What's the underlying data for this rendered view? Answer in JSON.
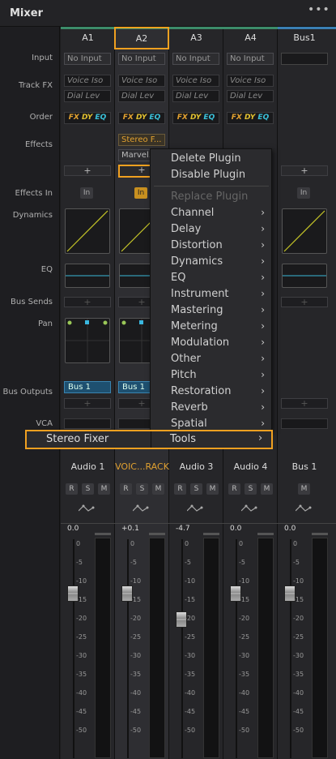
{
  "panel": {
    "title": "Mixer",
    "more": "•••"
  },
  "rows": {
    "input": "Input",
    "track_fx": "Track FX",
    "order": "Order",
    "effects": "Effects",
    "effects_in": "Effects In",
    "dynamics": "Dynamics",
    "eq": "EQ",
    "bus_sends": "Bus Sends",
    "pan": "Pan",
    "bus_outputs": "Bus Outputs",
    "vca": "VCA"
  },
  "channels": [
    {
      "id": "A1",
      "input": "No Input",
      "fx1": "Voice Iso",
      "fx2": "Dial Lev",
      "name": "Audio 1",
      "gain": "0.0",
      "bus_out": "Bus 1"
    },
    {
      "id": "A2",
      "input": "No Input",
      "fx1": "Voice Iso",
      "fx2": "Dial Lev",
      "name": "VOIC...RACK",
      "gain": "+0.1",
      "bus_out": "Bus 1",
      "effect1": "Stereo F...",
      "effect2": "Marvel...",
      "effects_in": "In"
    },
    {
      "id": "A3",
      "input": "No Input",
      "fx1": "Voice Iso",
      "fx2": "Dial Lev",
      "name": "Audio 3",
      "gain": "-4.7"
    },
    {
      "id": "A4",
      "input": "No Input",
      "fx1": "Voice Iso",
      "fx2": "Dial Lev",
      "name": "Audio 4",
      "gain": "0.0"
    },
    {
      "id": "Bus1",
      "name": "Bus 1",
      "gain": "0.0",
      "effects_in": "In"
    }
  ],
  "order_labels": {
    "fx": "FX",
    "dy": "DY",
    "eq": "EQ"
  },
  "effects_in_label": "In",
  "rsm": {
    "r": "R",
    "s": "S",
    "m": "M"
  },
  "plus": "+",
  "scale": [
    "0",
    "-5",
    "-10",
    "-15",
    "-20",
    "-25",
    "-30",
    "-35",
    "-40",
    "-45",
    "-50"
  ],
  "menu": {
    "delete": "Delete Plugin",
    "disable": "Disable Plugin",
    "replace": "Replace Plugin",
    "categories": [
      "Channel",
      "Delay",
      "Distortion",
      "Dynamics",
      "EQ",
      "Instrument",
      "Mastering",
      "Metering",
      "Modulation",
      "Other",
      "Pitch",
      "Restoration",
      "Reverb",
      "Spatial"
    ],
    "tools": "Tools",
    "submenu_item": "Stereo Fixer",
    "arrow": "›"
  }
}
